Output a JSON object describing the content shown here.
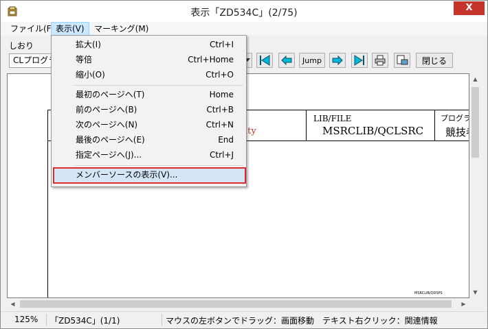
{
  "window": {
    "title": "表示「ZD534C」(2/75)",
    "close_glyph": "X"
  },
  "menubar": {
    "items": [
      {
        "label": "ファイル(F)"
      },
      {
        "label": "表示(V)"
      },
      {
        "label": "マーキング(M)"
      }
    ]
  },
  "toolbar": {
    "bookmark_label": "しおり",
    "bookmark_value": "CLプログラ",
    "jump_label": "Jump",
    "close_label": "閉じる"
  },
  "view_menu": {
    "items": [
      {
        "label": "拡大(I)",
        "shortcut": "Ctrl+I"
      },
      {
        "label": "等倍",
        "shortcut": "Ctrl+Home"
      },
      {
        "label": "縮小(O)",
        "shortcut": "Ctrl+O"
      },
      {
        "label": "最初のページへ(T)",
        "shortcut": "Home"
      },
      {
        "label": "前のページへ(B)",
        "shortcut": "Ctrl+B"
      },
      {
        "label": "次のページへ(N)",
        "shortcut": "Ctrl+N"
      },
      {
        "label": "最後のページへ(E)",
        "shortcut": "End"
      },
      {
        "label": "指定ページへ(J)...",
        "shortcut": "Ctrl+J"
      },
      {
        "label": "メンバーソースの表示(V)...",
        "shortcut": ""
      }
    ]
  },
  "document": {
    "lib_file_label": "LIB/FILE",
    "lib_file_value": "MSRCLIB/QCLSRC",
    "program_label": "プログラ",
    "program_value": "競技者",
    "red_fragment": "ity",
    "small_note": "MSRCLIB/QDSPS"
  },
  "statusbar": {
    "zoom": "125%",
    "page": "「ZD534C」(1/1)",
    "hint": "マウスの左ボタンでドラッグ：画面移動　テキスト右クリック：関連情報"
  },
  "colors": {
    "accent": "#00b7d8",
    "highlight_border": "#d92b2b",
    "menu_hover": "#cce8ff"
  }
}
